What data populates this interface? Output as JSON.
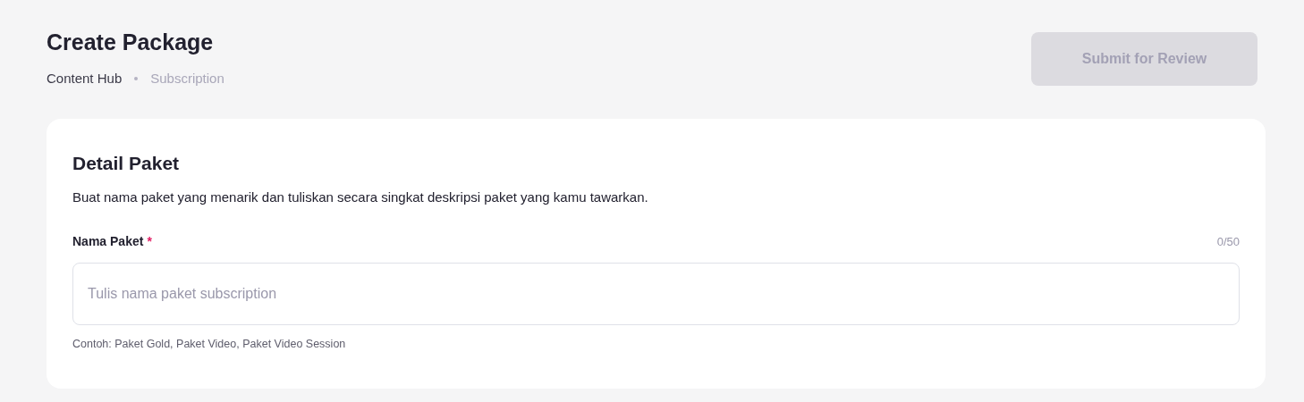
{
  "header": {
    "title": "Create Package",
    "breadcrumb": [
      {
        "label": "Content Hub",
        "current": false
      },
      {
        "label": "Subscription",
        "current": true
      }
    ],
    "submit_button": {
      "label": "Submit for Review",
      "disabled": true
    }
  },
  "card": {
    "title": "Detail Paket",
    "description": "Buat nama paket yang menarik dan tuliskan secara singkat deskripsi paket yang kamu tawarkan.",
    "field": {
      "label": "Nama Paket",
      "required_mark": "*",
      "counter": "0/50",
      "placeholder": "Tulis nama paket subscription",
      "hint": "Contoh: Paket Gold, Paket Video, Paket Video Session"
    }
  }
}
